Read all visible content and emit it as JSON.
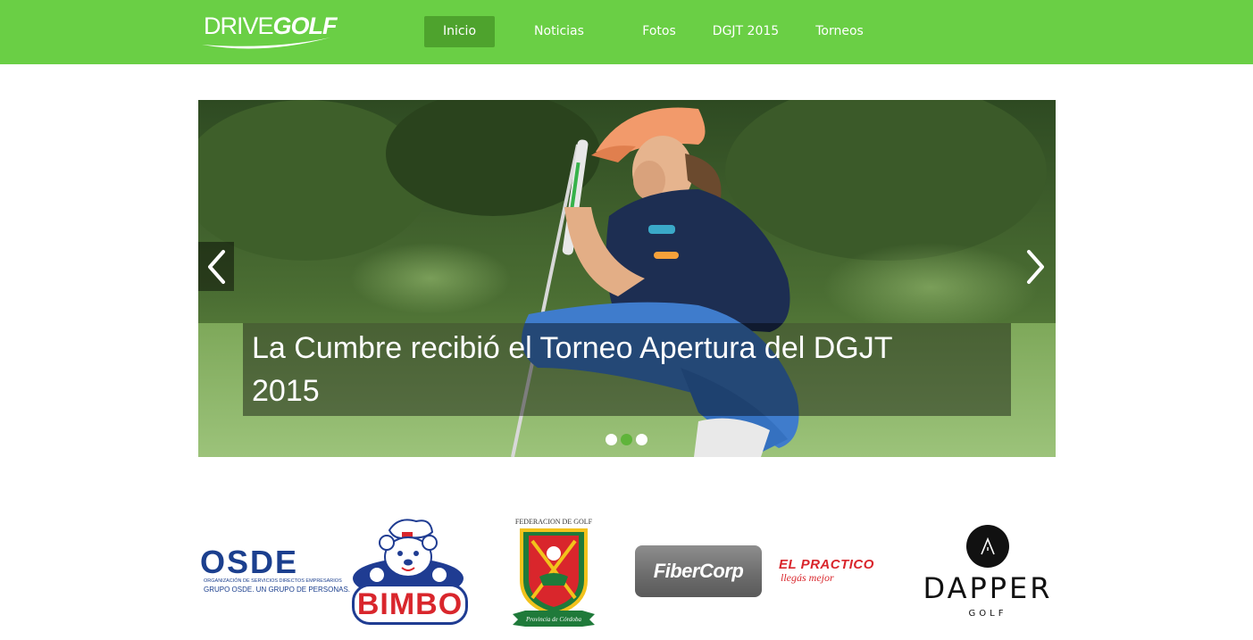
{
  "brand": {
    "logo_thin": "DRIVE",
    "logo_bold": "GOLF",
    "colors": {
      "header_green": "#6acf45",
      "active_green": "#4ea32d"
    }
  },
  "nav": {
    "items": [
      {
        "label": "Inicio",
        "active": true
      },
      {
        "label": "Noticias",
        "active": false
      },
      {
        "label": "Fotos",
        "active": false
      },
      {
        "label": "DGJT 2015",
        "active": false
      },
      {
        "label": "Torneos",
        "active": false
      }
    ]
  },
  "carousel": {
    "caption": "La Cumbre recibió el Torneo Apertura del DGJT 2015",
    "prev_icon": "chevron-left-icon",
    "next_icon": "chevron-right-icon",
    "slides": 3,
    "active_slide": 2
  },
  "sponsors": {
    "osde": {
      "name": "OSDE",
      "subtitle": "ORGANIZACIÓN DE SERVICIOS DIRECTOS EMPRESARIOS",
      "tagline": "GRUPO OSDE. UN GRUPO DE PERSONAS."
    },
    "bimbo": {
      "name": "BIMBO"
    },
    "federacion": {
      "top": "FEDERACION DE GOLF",
      "ribbon": "Provincia de Córdoba"
    },
    "fibercorp": {
      "name": "FiberCorp"
    },
    "elpractico": {
      "name": "EL PRACTICO",
      "tagline": "llegás mejor"
    },
    "dapper": {
      "name": "DAPPER",
      "sub": "GOLF"
    }
  }
}
